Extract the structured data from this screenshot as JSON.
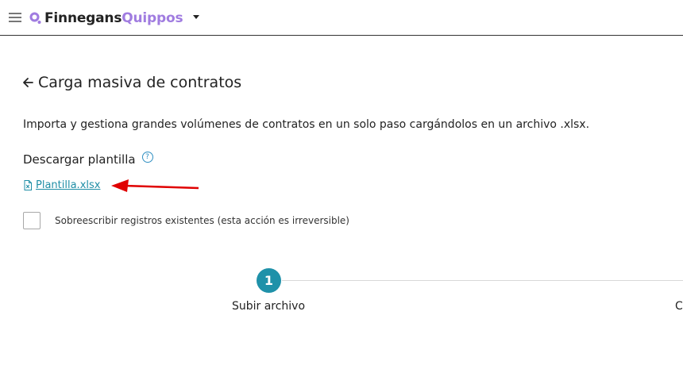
{
  "topbar": {
    "logo_primary": "Finnegans",
    "logo_secondary": "Quippos",
    "colors": {
      "logo_secondary": "#a07ce0",
      "border": "#333333"
    },
    "icons": {
      "menu": "hamburger-icon",
      "logo_mark": "finnegans-logo-icon",
      "caret": "caret-down-icon"
    }
  },
  "page": {
    "title": "Carga masiva de contratos",
    "description": "Importa y gestiona grandes volúmenes de contratos en un solo paso cargándolos en un archivo .xlsx."
  },
  "template_section": {
    "title": "Descargar plantilla",
    "help_glyph": "?",
    "file_name": "Plantilla.xlsx",
    "link_color": "#1f8ea6"
  },
  "overwrite_option": {
    "label": "Sobreescribir registros existentes (esta acción es irreversible)",
    "checked": false
  },
  "stepper": {
    "steps": [
      {
        "number": "1",
        "label": "Subir archivo",
        "active": true
      },
      {
        "label": "C"
      }
    ],
    "accent": "#1f91a9"
  },
  "annotation": {
    "arrow_color": "#e00000"
  }
}
